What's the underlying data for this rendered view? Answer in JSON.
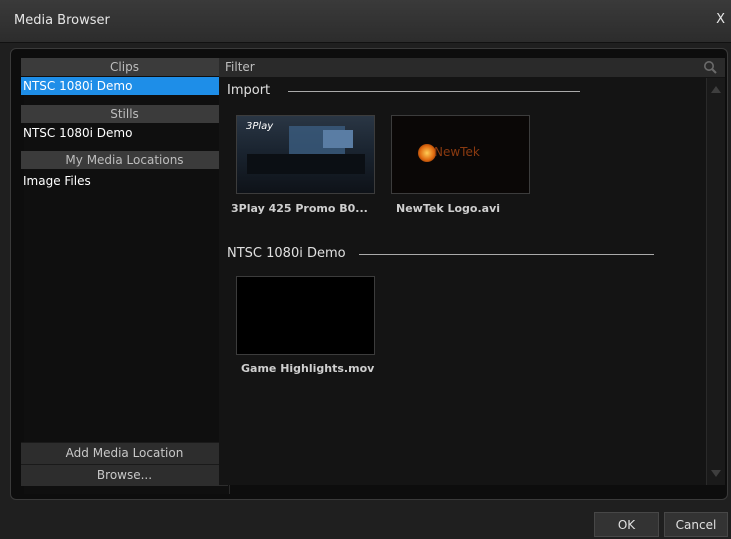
{
  "window": {
    "title": "Media Browser",
    "close": "X"
  },
  "sidebar": {
    "clips_header": "Clips",
    "clips_item": "NTSC 1080i Demo",
    "stills_header": "Stills",
    "stills_item": "NTSC 1080i Demo",
    "locations_header": "My Media Locations",
    "locations_item": "Image Files",
    "add_location": "Add Media Location",
    "browse": "Browse..."
  },
  "main": {
    "filter_placeholder": "Filter",
    "sections": [
      {
        "title": "Import",
        "items": [
          "3Play 425 Promo B0...",
          "NewTek Logo.avi"
        ]
      },
      {
        "title": "NTSC 1080i Demo",
        "items": [
          "Game Highlights.mov"
        ]
      }
    ],
    "thumb_texts": {
      "threeplay": "3Play",
      "newtek": "NewTek"
    }
  },
  "footer": {
    "ok": "OK",
    "cancel": "Cancel"
  },
  "colors": {
    "selection": "#1e8ee8",
    "background": "#1f1f1f"
  }
}
